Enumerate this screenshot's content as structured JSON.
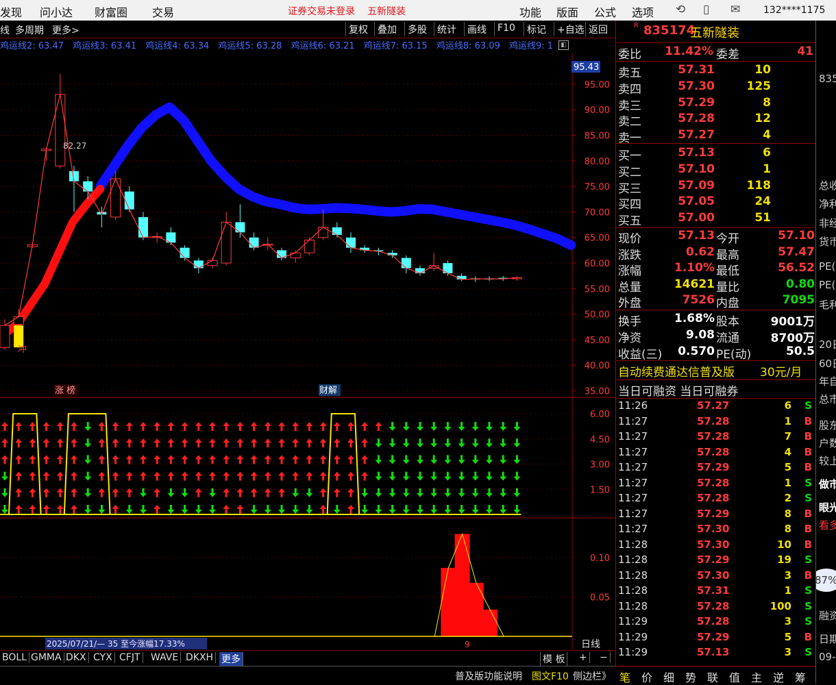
{
  "menu": {
    "items": [
      "发现",
      "问小达",
      "财富圈",
      "交易"
    ],
    "alert": "证券交易未登录",
    "stock_short": "五新隧装",
    "right_items": [
      "功能",
      "版面",
      "公式",
      "选项"
    ],
    "user": "132****1175"
  },
  "chart_toolbar": {
    "left": [
      "线",
      "多周期",
      "更多>"
    ],
    "buttons": [
      "复权",
      "叠加",
      "多股",
      "统计",
      "画线",
      "F10",
      "标记",
      "+自选",
      "返回"
    ]
  },
  "ma_legend": [
    "鸡运线2: 63.47",
    "鸡运线3: 63.41",
    "鸡运线4: 63.34",
    "鸡运线5: 63.28",
    "鸡运线6: 63.21",
    "鸡运线7: 63.15",
    "鸡运线8: 63.09",
    "鸡运线9: 1"
  ],
  "main_chart": {
    "y_ticks": [
      "95.00",
      "90.00",
      "85.00",
      "80.00",
      "75.00",
      "70.00",
      "65.00",
      "60.00",
      "55.00",
      "50.00",
      "45.00",
      "40.00",
      "35.00"
    ],
    "price_tag": "95.43",
    "high_label": "82.27",
    "chong_label": "冲",
    "zhangbang_label": "涨 榜",
    "caijie_label": "财解"
  },
  "chart_data": [
    {
      "type": "candlestick",
      "title": "",
      "ylim": [
        35,
        95.43
      ],
      "candles": [
        {
          "o": 43.5,
          "c": 47.8,
          "h": 49,
          "l": 43
        },
        {
          "o": 48,
          "c": 49.5,
          "h": 51,
          "l": 47
        },
        {
          "o": 63.2,
          "c": 63.6,
          "h": 64,
          "l": 63
        },
        {
          "o": 82,
          "c": 82.3,
          "h": 82.5,
          "l": 80
        },
        {
          "o": 79,
          "c": 93,
          "h": 97,
          "l": 78.5
        },
        {
          "o": 78,
          "c": 76,
          "h": 79,
          "l": 70
        },
        {
          "o": 76,
          "c": 74,
          "h": 77,
          "l": 72.5
        },
        {
          "o": 70,
          "c": 69.5,
          "h": 71,
          "l": 67
        },
        {
          "o": 69,
          "c": 76.5,
          "h": 78,
          "l": 68.5
        },
        {
          "o": 74,
          "c": 70.5,
          "h": 75,
          "l": 70
        },
        {
          "o": 69,
          "c": 65,
          "h": 70,
          "l": 64.5
        },
        {
          "o": 65,
          "c": 65.2,
          "h": 66,
          "l": 64
        },
        {
          "o": 66,
          "c": 64,
          "h": 67,
          "l": 63.5
        },
        {
          "o": 63,
          "c": 61,
          "h": 63.5,
          "l": 60.5
        },
        {
          "o": 60.5,
          "c": 59,
          "h": 61,
          "l": 58
        },
        {
          "o": 59.5,
          "c": 60.5,
          "h": 61,
          "l": 59
        },
        {
          "o": 60,
          "c": 68,
          "h": 70,
          "l": 59.5
        },
        {
          "o": 68,
          "c": 66,
          "h": 71.5,
          "l": 65
        },
        {
          "o": 65,
          "c": 63,
          "h": 66,
          "l": 62.5
        },
        {
          "o": 63.5,
          "c": 63.7,
          "h": 65,
          "l": 62.5
        },
        {
          "o": 62.5,
          "c": 61,
          "h": 63,
          "l": 60.5
        },
        {
          "o": 61,
          "c": 62,
          "h": 62.5,
          "l": 60
        },
        {
          "o": 62,
          "c": 64.5,
          "h": 65,
          "l": 61.5
        },
        {
          "o": 65,
          "c": 67,
          "h": 70.5,
          "l": 64.5
        },
        {
          "o": 67,
          "c": 65.5,
          "h": 68,
          "l": 65
        },
        {
          "o": 65,
          "c": 63,
          "h": 66,
          "l": 62
        },
        {
          "o": 63,
          "c": 62.5,
          "h": 63.5,
          "l": 62
        },
        {
          "o": 62.5,
          "c": 62.3,
          "h": 63,
          "l": 61.5
        },
        {
          "o": 62,
          "c": 61.5,
          "h": 62.5,
          "l": 61
        },
        {
          "o": 61,
          "c": 59,
          "h": 61.5,
          "l": 58
        },
        {
          "o": 59,
          "c": 58,
          "h": 59.5,
          "l": 57.5
        },
        {
          "o": 59,
          "c": 59.5,
          "h": 62,
          "l": 58.5
        },
        {
          "o": 60,
          "c": 58,
          "h": 60.5,
          "l": 57.5
        },
        {
          "o": 57.5,
          "c": 56.8,
          "h": 58,
          "l": 56.5
        },
        {
          "o": 57,
          "c": 56.9,
          "h": 57.4,
          "l": 56.3
        },
        {
          "o": 57,
          "c": 56.9,
          "h": 57.4,
          "l": 56.5
        },
        {
          "o": 57.1,
          "c": 56.9,
          "h": 57.5,
          "l": 56.5
        },
        {
          "o": 57.1,
          "c": 57.13,
          "h": 57.47,
          "l": 56.52
        }
      ],
      "red_line": [
        45,
        45.5,
        46,
        48,
        52,
        56,
        62,
        68,
        71.5,
        74.5
      ],
      "blue_line": [
        75,
        79,
        83,
        86.5,
        89,
        90.5,
        88,
        84,
        80,
        77,
        74.5,
        73,
        72,
        71.5,
        70.8,
        70.5,
        70.6,
        70.8,
        70.7,
        70.5,
        70.2,
        70.0,
        70.2,
        70.6,
        70.5,
        70.0,
        69.5,
        69.0,
        68.5,
        68.0,
        67.4,
        66.6,
        65.7,
        64.8,
        63.5
      ]
    },
    {
      "type": "signal",
      "y_ticks": [
        "6.00",
        "4.50",
        "3.00",
        "1.50"
      ],
      "ylim": [
        0,
        6
      ],
      "yellow_line": [
        0,
        6,
        6,
        0,
        0,
        6,
        6,
        6,
        0,
        0,
        0,
        0,
        0,
        0,
        0,
        0,
        0,
        0,
        0,
        0,
        0,
        0,
        0,
        0,
        6,
        6,
        0,
        0,
        0,
        0,
        0,
        0,
        0,
        0,
        0,
        0,
        0,
        0
      ],
      "red_counts": [
        3,
        6,
        6,
        6,
        6,
        6,
        0,
        5,
        6,
        5,
        4,
        6,
        4,
        4,
        5,
        4,
        6,
        6,
        5,
        5,
        5,
        4,
        4,
        6,
        5,
        6,
        4,
        1,
        0,
        0,
        0,
        0,
        0,
        0,
        0,
        0,
        0,
        0
      ]
    },
    {
      "type": "histogram",
      "y_ticks": [
        "0.10",
        "0.05"
      ],
      "ylim": [
        0,
        0.14
      ],
      "bars": [
        0,
        0,
        0,
        0,
        0,
        0,
        0,
        0,
        0,
        0,
        0,
        0,
        0,
        0,
        0,
        0,
        0,
        0,
        0,
        0,
        0,
        0,
        0,
        0,
        0,
        0,
        0,
        0,
        0,
        0,
        0,
        0,
        0.087,
        0.13,
        0.068,
        0.034,
        0,
        0
      ],
      "info": "2025/07/21/— 35 至今涨幅17.33%",
      "marker": "9",
      "period": "日线"
    }
  ],
  "quote": {
    "code": "835174",
    "name": "五新隧装",
    "webi_label": "委比",
    "webi": "11.42%",
    "weicha_label": "委差",
    "weicha": "41",
    "sells": [
      {
        "label": "卖五",
        "price": "57.31",
        "vol": "10"
      },
      {
        "label": "卖四",
        "price": "57.30",
        "vol": "125"
      },
      {
        "label": "卖三",
        "price": "57.29",
        "vol": "8"
      },
      {
        "label": "卖二",
        "price": "57.28",
        "vol": "12"
      },
      {
        "label": "卖一",
        "price": "57.27",
        "vol": "4"
      }
    ],
    "buys": [
      {
        "label": "买一",
        "price": "57.13",
        "vol": "6"
      },
      {
        "label": "买二",
        "price": "57.10",
        "vol": "1"
      },
      {
        "label": "买三",
        "price": "57.09",
        "vol": "118"
      },
      {
        "label": "买四",
        "price": "57.05",
        "vol": "24"
      },
      {
        "label": "买五",
        "price": "57.00",
        "vol": "51"
      }
    ],
    "stats": [
      {
        "l1": "现价",
        "v1": "57.13",
        "c1": "red",
        "l2": "今开",
        "v2": "57.10",
        "c2": "red"
      },
      {
        "l1": "涨跌",
        "v1": "0.62",
        "c1": "red",
        "l2": "最高",
        "v2": "57.47",
        "c2": "red"
      },
      {
        "l1": "涨幅",
        "v1": "1.10%",
        "c1": "red",
        "l2": "最低",
        "v2": "56.52",
        "c2": "red"
      },
      {
        "l1": "总量",
        "v1": "14621",
        "c1": "yel",
        "l2": "量比",
        "v2": "0.80",
        "c2": "grn"
      },
      {
        "l1": "外盘",
        "v1": "7526",
        "c1": "red",
        "l2": "内盘",
        "v2": "7095",
        "c2": "grn"
      }
    ],
    "fund": [
      {
        "l1": "换手",
        "v1": "1.68%",
        "l2": "股本",
        "v2": "9001万"
      },
      {
        "l1": "净资",
        "v1": "9.08",
        "l2": "流通",
        "v2": "8700万"
      },
      {
        "l1": "收益(三)",
        "v1": "0.570",
        "l2": "PE(动)",
        "v2": "50.5"
      }
    ],
    "promo": "自动续费通达信普及版",
    "promo_price": "30元/月",
    "margin": "当日可融资 当日可融券"
  },
  "ticks": [
    {
      "t": "11:26",
      "p": "57.27",
      "v": "6",
      "bs": "S"
    },
    {
      "t": "11:27",
      "p": "57.28",
      "v": "1",
      "bs": "B"
    },
    {
      "t": "11:27",
      "p": "57.28",
      "v": "7",
      "bs": "B"
    },
    {
      "t": "11:27",
      "p": "57.28",
      "v": "4",
      "bs": "B"
    },
    {
      "t": "11:27",
      "p": "57.29",
      "v": "5",
      "bs": "B"
    },
    {
      "t": "11:27",
      "p": "57.28",
      "v": "1",
      "bs": "S"
    },
    {
      "t": "11:27",
      "p": "57.28",
      "v": "2",
      "bs": "S"
    },
    {
      "t": "11:27",
      "p": "57.29",
      "v": "8",
      "bs": "B"
    },
    {
      "t": "11:27",
      "p": "57.30",
      "v": "8",
      "bs": "B"
    },
    {
      "t": "11:28",
      "p": "57.30",
      "v": "10",
      "bs": "B"
    },
    {
      "t": "11:28",
      "p": "57.29",
      "v": "19",
      "bs": "S"
    },
    {
      "t": "11:28",
      "p": "57.30",
      "v": "3",
      "bs": "B"
    },
    {
      "t": "11:28",
      "p": "57.31",
      "v": "1",
      "bs": "S"
    },
    {
      "t": "11:28",
      "p": "57.28",
      "v": "100",
      "bs": "S"
    },
    {
      "t": "11:29",
      "p": "57.28",
      "v": "3",
      "bs": "S"
    },
    {
      "t": "11:29",
      "p": "57.29",
      "v": "5",
      "bs": "B"
    },
    {
      "t": "11:29",
      "p": "57.13",
      "v": "3",
      "bs": "S"
    }
  ],
  "far_right": [
    "835",
    "总收",
    "净利",
    "非经",
    "货币",
    "PE(",
    "PE(",
    "毛利",
    "20日",
    "60日",
    "年自",
    "总市",
    "股东",
    "户数",
    "较上",
    "做市",
    "眼光",
    "看多",
    "87%",
    "融资",
    "日期",
    "09-"
  ],
  "bottom_tabs": [
    "BOLL",
    "GMMA",
    "DKX",
    "CYX",
    "CFJT",
    "WAVE",
    "DKXH",
    "更多"
  ],
  "bottom_right": [
    "模 板",
    "+",
    "−"
  ],
  "status": [
    "普及版功能说明",
    "图文F10",
    "侧边栏》"
  ],
  "right_tabs": [
    "笔",
    "价",
    "细",
    "势",
    "联",
    "值",
    "主",
    "逆",
    "筹"
  ]
}
